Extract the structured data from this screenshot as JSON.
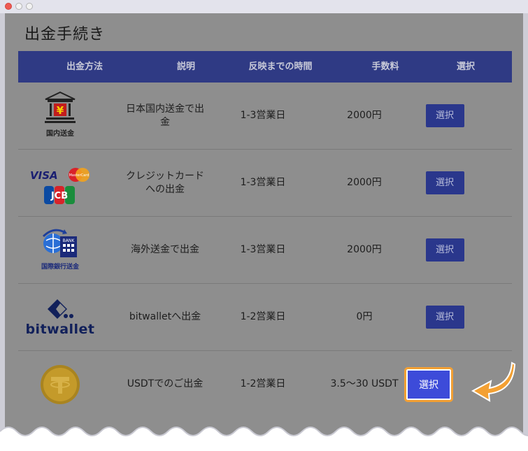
{
  "page": {
    "title": "出金手続き"
  },
  "table": {
    "headers": [
      "出金方法",
      "説明",
      "反映までの時間",
      "手数料",
      "選択"
    ],
    "rows": [
      {
        "method_icon": "domestic-bank-icon",
        "method_label": "国内送金",
        "description": "日本国内送金で出金",
        "time": "1-3営業日",
        "fee": "2000円",
        "select": "選択"
      },
      {
        "method_icon": "credit-card-icon",
        "method_label": "VISA / MasterCard / JCB",
        "description": "クレジットカードへの出金",
        "time": "1-3営業日",
        "fee": "2000円",
        "select": "選択"
      },
      {
        "method_icon": "international-bank-icon",
        "method_label": "国際銀行送金",
        "description": "海外送金で出金",
        "time": "1-3営業日",
        "fee": "2000円",
        "select": "選択"
      },
      {
        "method_icon": "bitwallet-icon",
        "method_label": "bitwallet",
        "description": "bitwalletへ出金",
        "time": "1-2営業日",
        "fee": "0円",
        "select": "選択"
      },
      {
        "method_icon": "usdt-coin-icon",
        "method_label": "",
        "description": "USDTでのご出金",
        "time": "1-2営業日",
        "fee": "3.5〜30 USDT",
        "select": "選択"
      }
    ]
  },
  "highlight": {
    "color": "#f3a033",
    "button_color": "#3d4bd9"
  },
  "card_brands": {
    "visa": "VISA",
    "mastercard": "MasterCard",
    "jcb": "JCB"
  }
}
